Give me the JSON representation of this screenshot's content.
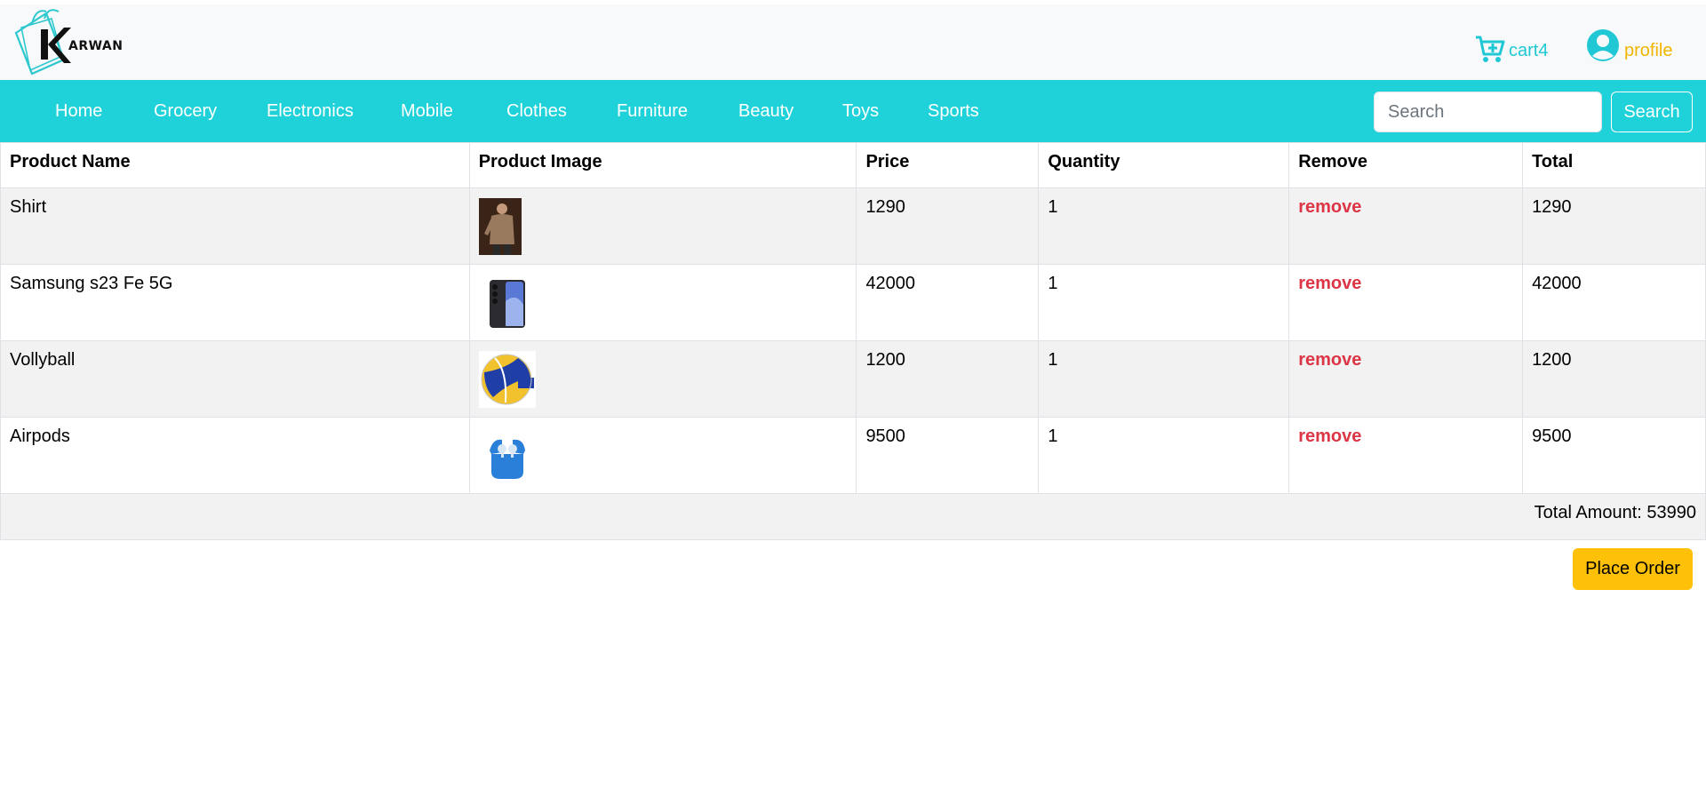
{
  "brand": {
    "logo_text": "ARWAN"
  },
  "header": {
    "cart_label": "cart4",
    "profile_label": "profile"
  },
  "nav": {
    "items": [
      "Home",
      "Grocery",
      "Electronics",
      "Mobile",
      "Clothes",
      "Furniture",
      "Beauty",
      "Toys",
      "Sports"
    ]
  },
  "search": {
    "placeholder": "Search",
    "value": "",
    "button_label": "Search"
  },
  "table": {
    "headers": [
      "Product Name",
      "Product Image",
      "Price",
      "Quantity",
      "Remove",
      "Total"
    ],
    "rows": [
      {
        "name": "Shirt",
        "image": "shirt-photo",
        "price": "1290",
        "quantity": "1",
        "remove": "remove",
        "total": "1290"
      },
      {
        "name": "Samsung s23 Fe 5G",
        "image": "phone-photo",
        "price": "42000",
        "quantity": "1",
        "remove": "remove",
        "total": "42000"
      },
      {
        "name": "Vollyball",
        "image": "volleyball-photo",
        "price": "1200",
        "quantity": "1",
        "remove": "remove",
        "total": "1200"
      },
      {
        "name": "Airpods",
        "image": "airpods-photo",
        "price": "9500",
        "quantity": "1",
        "remove": "remove",
        "total": "9500"
      }
    ],
    "total_amount_label": "Total Amount: 53990"
  },
  "actions": {
    "place_order_label": "Place Order"
  },
  "colors": {
    "nav_bg": "#1fd2da",
    "cart_color": "#1fc8d4",
    "profile_color": "#f2b600",
    "remove_color": "#dc3545",
    "order_btn": "#ffc107"
  }
}
